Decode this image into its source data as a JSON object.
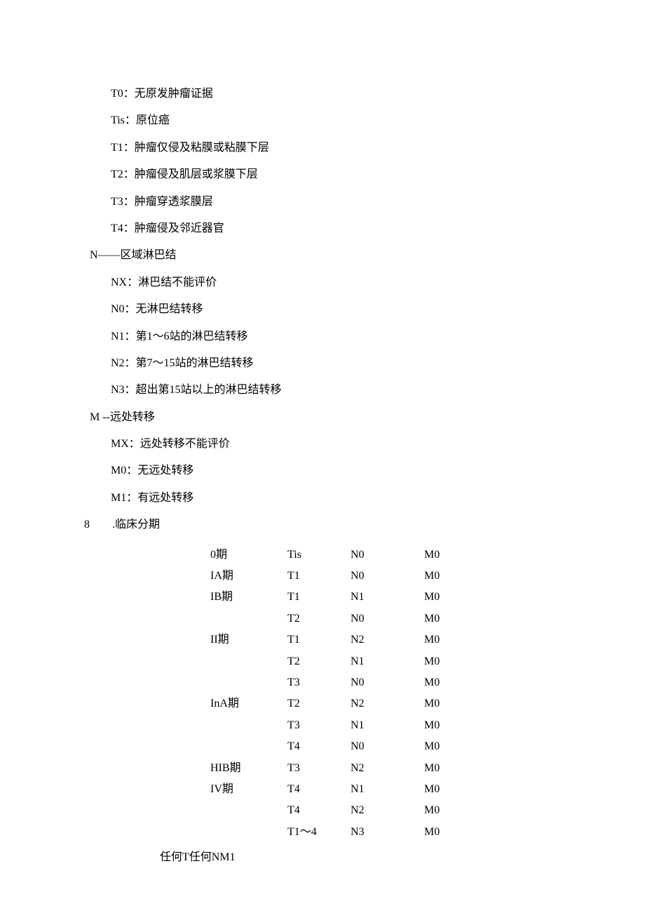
{
  "t_section": {
    "t0": "T0：无原发肿瘤证据",
    "tis": "Tis：原位癌",
    "t1": "T1：肿瘤仅侵及粘膜或粘膜下层",
    "t2": "T2：肿瘤侵及肌层或浆膜下层",
    "t3": "T3：肿瘤穿透浆膜层",
    "t4": "T4：肿瘤侵及邻近器官"
  },
  "n_section": {
    "heading": "N——区域淋巴结",
    "nx": "NX：淋巴结不能评价",
    "n0": "N0：无淋巴结转移",
    "n1": "N1：第1～6站的淋巴结转移",
    "n2": "N2：第7～15站的淋巴结转移",
    "n3": "N3：超出第15站以上的淋巴结转移"
  },
  "m_section": {
    "heading": "M --远处转移",
    "mx": "MX：远处转移不能评价",
    "m0": "M0：无远处转移",
    "m1": "M1：有远处转移"
  },
  "clinical_staging": {
    "num": "8",
    "label": ".临床分期"
  },
  "stage_rows": [
    {
      "stage": "0期",
      "t": "Tis",
      "n": "N0",
      "m": "M0"
    },
    {
      "stage": "IA期",
      "t": "T1",
      "n": "N0",
      "m": "M0"
    },
    {
      "stage": "IB期",
      "t": "T1",
      "n": "N1",
      "m": "M0"
    },
    {
      "stage": "",
      "t": "T2",
      "n": "N0",
      "m": "M0"
    },
    {
      "stage": "II期",
      "t": "T1",
      "n": "N2",
      "m": "M0"
    },
    {
      "stage": "",
      "t": "T2",
      "n": "N1",
      "m": "M0"
    },
    {
      "stage": "",
      "t": "T3",
      "n": "N0",
      "m": "M0"
    },
    {
      "stage": "InA期",
      "t": "T2",
      "n": "N2",
      "m": "M0"
    },
    {
      "stage": "",
      "t": "T3",
      "n": "N1",
      "m": "M0"
    },
    {
      "stage": "",
      "t": "T4",
      "n": "N0",
      "m": "M0"
    },
    {
      "stage": "HIB期",
      "t": "T3",
      "n": "N2",
      "m": "M0"
    },
    {
      "stage": "IV期",
      "t": "T4",
      "n": "N1",
      "m": "M0"
    },
    {
      "stage": "",
      "t": "T4",
      "n": "N2",
      "m": "M0"
    },
    {
      "stage": "",
      "t": "T1～4",
      "n": "N3",
      "m": "M0"
    }
  ],
  "footer_line": "任何T任何NM1"
}
